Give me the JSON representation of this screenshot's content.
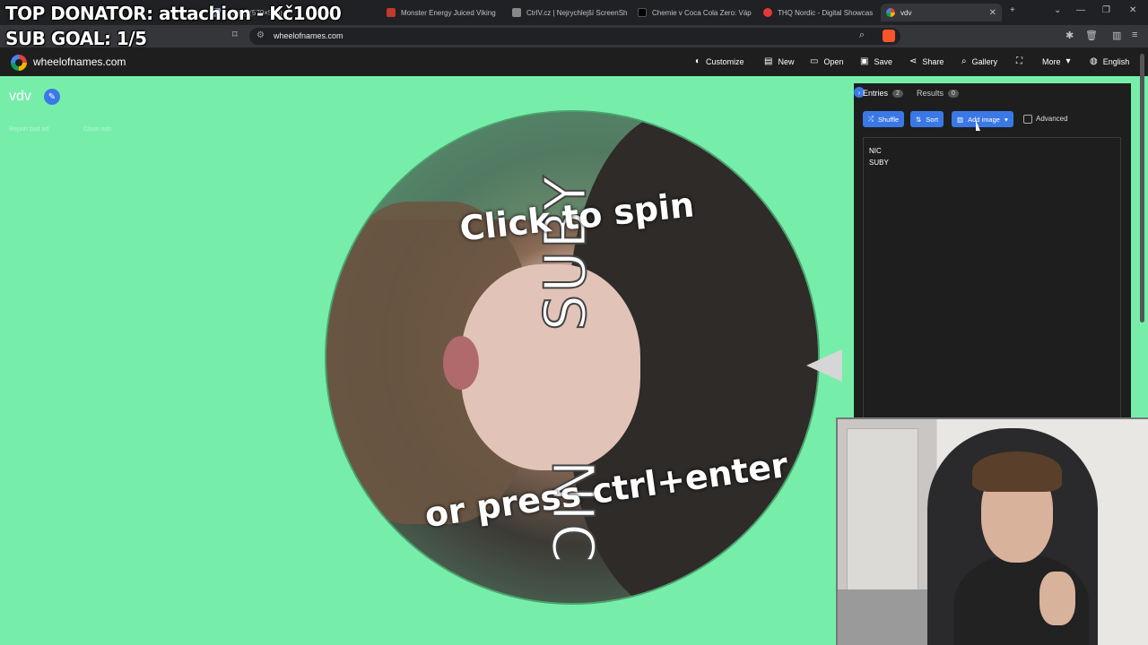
{
  "overlay": {
    "top_donator": "TOP DONATOR: attachion - Kč1000",
    "sub_goal": "SUB GOAL: 1/5"
  },
  "browser": {
    "tabs": [
      {
        "label": "...3.jpg (570×570)",
        "color": "#8ab4f8"
      },
      {
        "label": "Monster Energy Juiced Viking",
        "color": "#c0392b"
      },
      {
        "label": "CtrlV.cz | Nejrychlejší ScreenSh",
        "color": "#888888"
      },
      {
        "label": "Chemie v Coca Cola Zero: Váp",
        "color": "#000000"
      },
      {
        "label": "THQ Nordic - Digital Showcas",
        "color": "#e53935"
      },
      {
        "label": "vdv",
        "color": "#4285f4"
      }
    ],
    "url": "wheelofnames.com"
  },
  "site": {
    "name": "wheelofnames.com",
    "nav": {
      "customize": "Customize",
      "new": "New",
      "open": "Open",
      "save": "Save",
      "share": "Share",
      "gallery": "Gallery",
      "more": "More",
      "language": "English"
    }
  },
  "wheel": {
    "title": "vdv",
    "report_ad": "Report bad ad",
    "close_ads": "Close ads",
    "spin_line1": "Click to spin",
    "spin_line2": "or press ctrl+enter",
    "segments": [
      "SUBY",
      "NIC"
    ]
  },
  "panel": {
    "entries_tab": "Entries",
    "entries_count": "2",
    "results_tab": "Results",
    "results_count": "0",
    "shuffle": "Shuffle",
    "sort": "Sort",
    "add_image": "Add image",
    "advanced": "Advanced",
    "entries": [
      "NIC",
      "SUBY"
    ]
  }
}
